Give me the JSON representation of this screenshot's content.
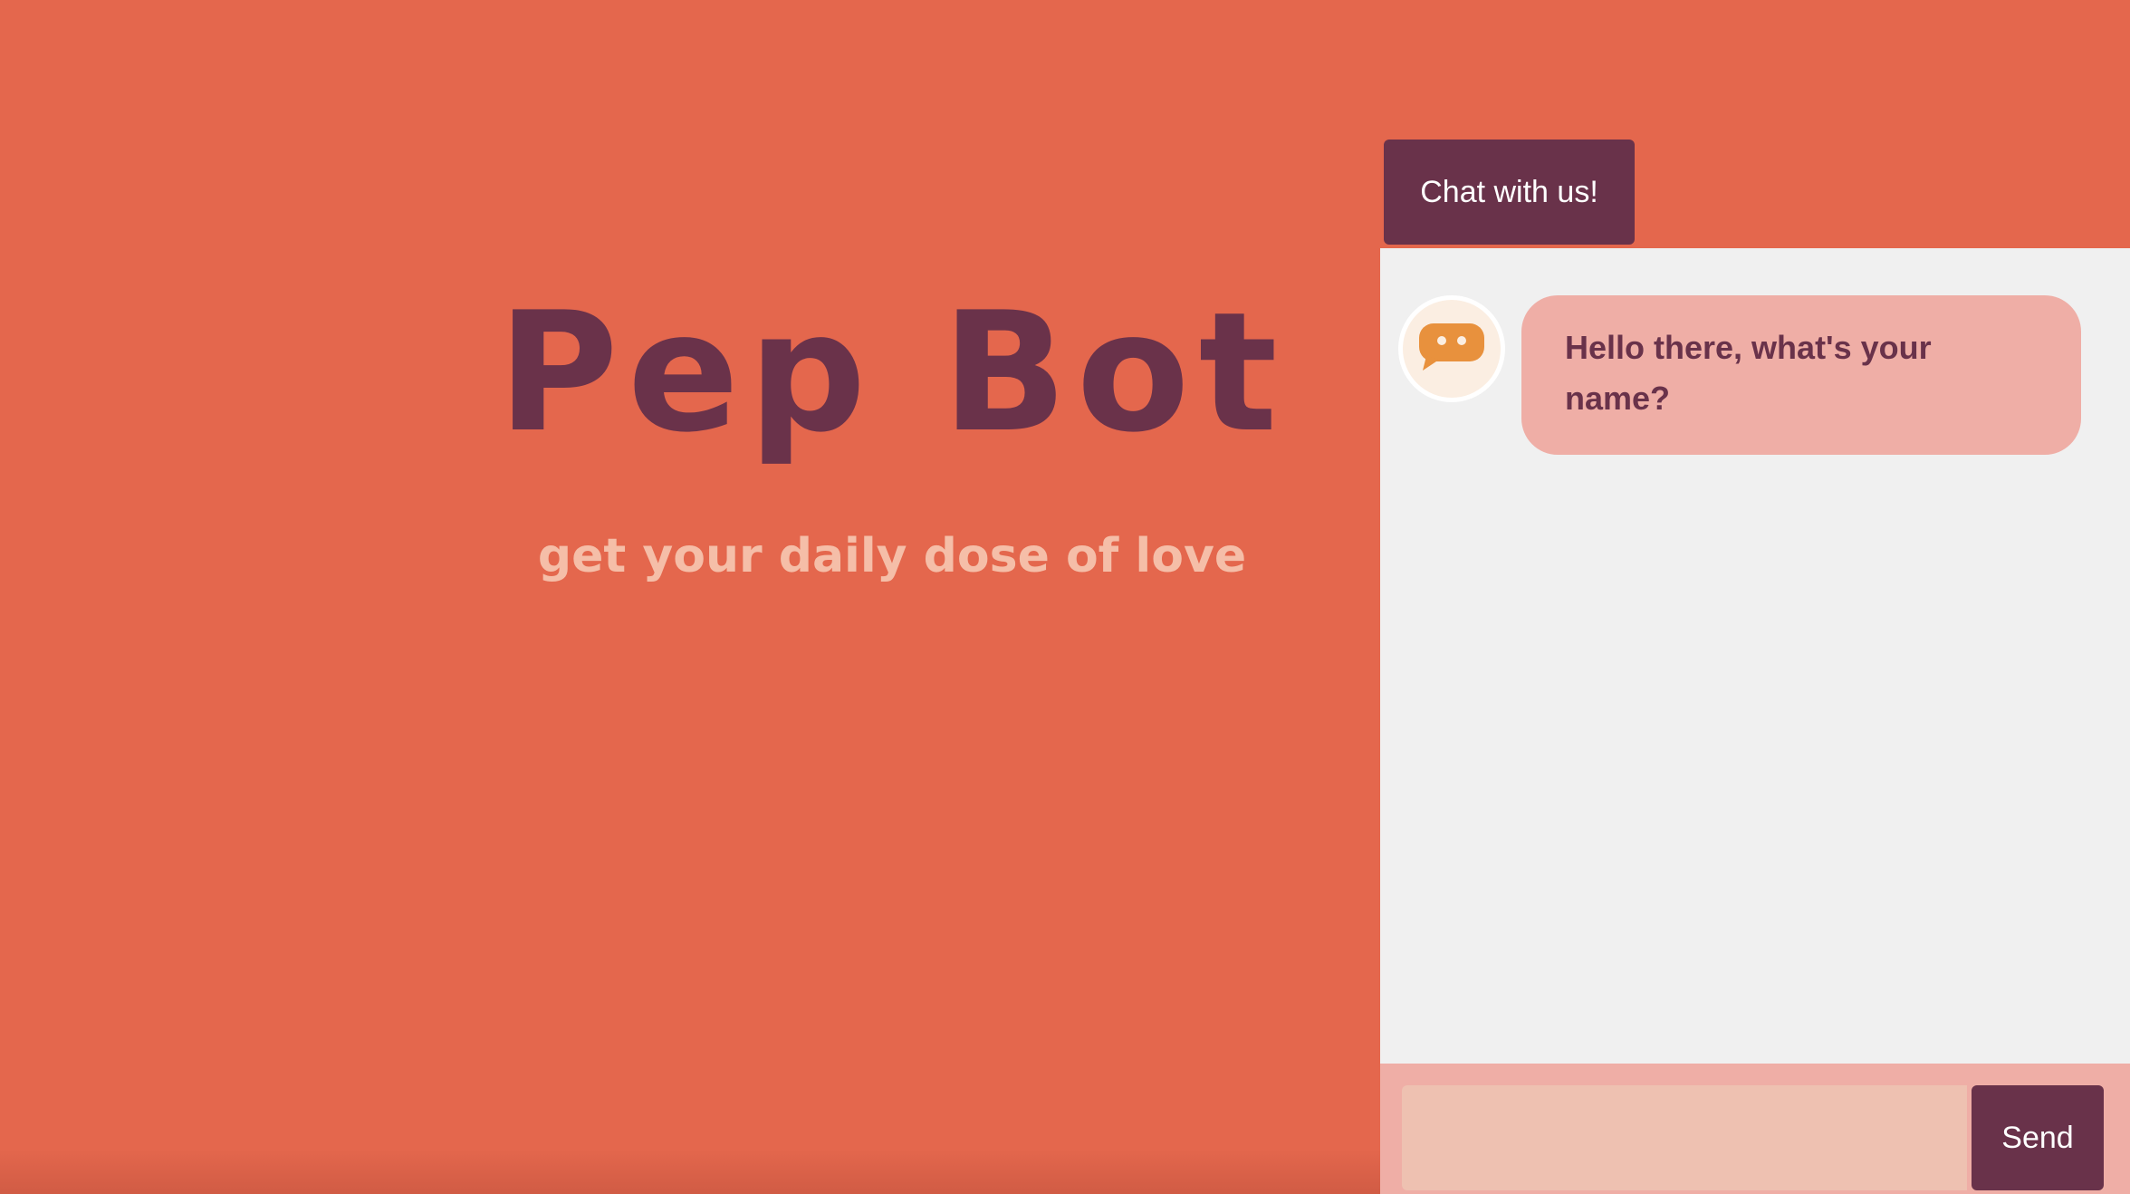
{
  "hero": {
    "title": "Pep Bot",
    "subtitle": "get your daily dose of love"
  },
  "chat": {
    "tab_label": "Chat with us!",
    "messages": [
      {
        "sender": "bot",
        "text": "Hello there, what's your name?",
        "avatar_icon": "chat-bubble-icon"
      }
    ],
    "input": {
      "value": "",
      "placeholder": ""
    },
    "send_label": "Send"
  },
  "colors": {
    "background": "#E4674D",
    "brand_dark": "#69324A",
    "subtitle": "#F5BEA8",
    "chat_panel": "#F0F0F0",
    "bubble": "#EFAEA6",
    "input_field": "#EEC1B1",
    "avatar_icon": "#E8913D"
  }
}
